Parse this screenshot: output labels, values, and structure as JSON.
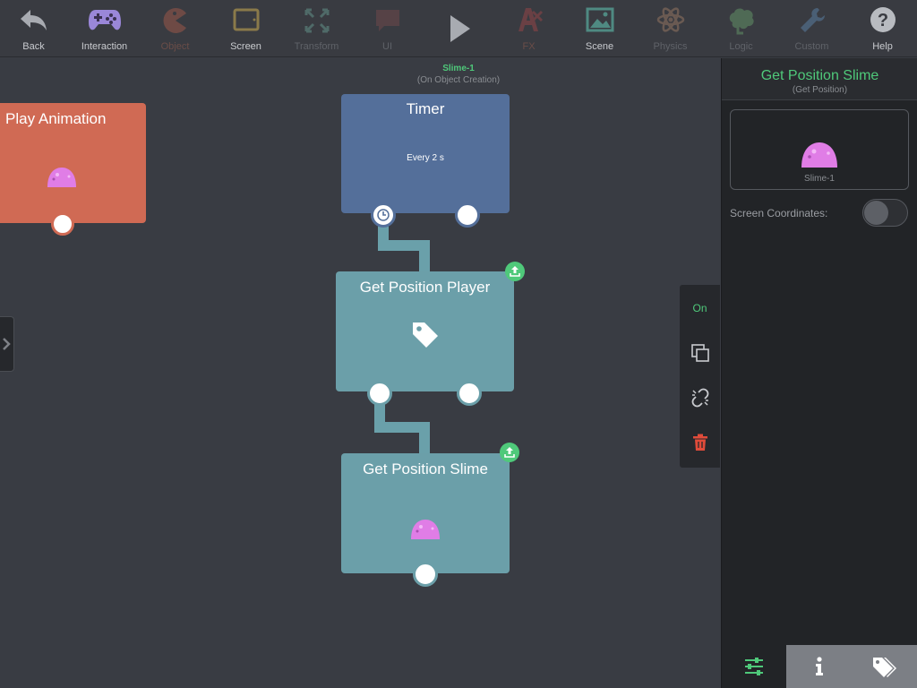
{
  "toolbar": {
    "items": [
      {
        "label": "Back",
        "icon": "back-arrow-icon"
      },
      {
        "label": "Interaction",
        "icon": "gamepad-icon"
      },
      {
        "label": "Object",
        "icon": "pacman-icon"
      },
      {
        "label": "Screen",
        "icon": "tablet-icon"
      },
      {
        "label": "Transform",
        "icon": "expand-arrows-icon"
      },
      {
        "label": "UI",
        "icon": "chat-bubble-icon"
      },
      {
        "label": "FX",
        "icon": "fx-icon"
      },
      {
        "label": "Scene",
        "icon": "landscape-image-icon"
      },
      {
        "label": "Physics",
        "icon": "atom-icon"
      },
      {
        "label": "Logic",
        "icon": "brain-icon"
      },
      {
        "label": "Custom",
        "icon": "wrench-icon"
      },
      {
        "label": "Help",
        "icon": "question-icon"
      }
    ],
    "play_icon": "play-icon"
  },
  "canvas": {
    "event_caption": {
      "object": "Slime-1",
      "trigger": "(On Object Creation)"
    },
    "blocks": {
      "play_animation": {
        "title": "Play Animation"
      },
      "timer": {
        "title": "Timer",
        "subtitle": "Every 2 s"
      },
      "get_position_player": {
        "title": "Get Position Player"
      },
      "get_position_slime": {
        "title": "Get Position Slime"
      }
    }
  },
  "side_tools": {
    "on_label": "On"
  },
  "panel": {
    "title": "Get Position Slime",
    "subtitle": "(Get Position)",
    "preview_label": "Slime-1",
    "screen_coordinates_label": "Screen Coordinates:",
    "screen_coordinates_on": false
  },
  "colors": {
    "accent_green": "#4fc97a",
    "play_animation_block": "#d06a54",
    "timer_block": "#546f9a",
    "logic_block": "#6b9fa9",
    "slime_pink": "#e07de6",
    "delete_red": "#e04b3a"
  }
}
